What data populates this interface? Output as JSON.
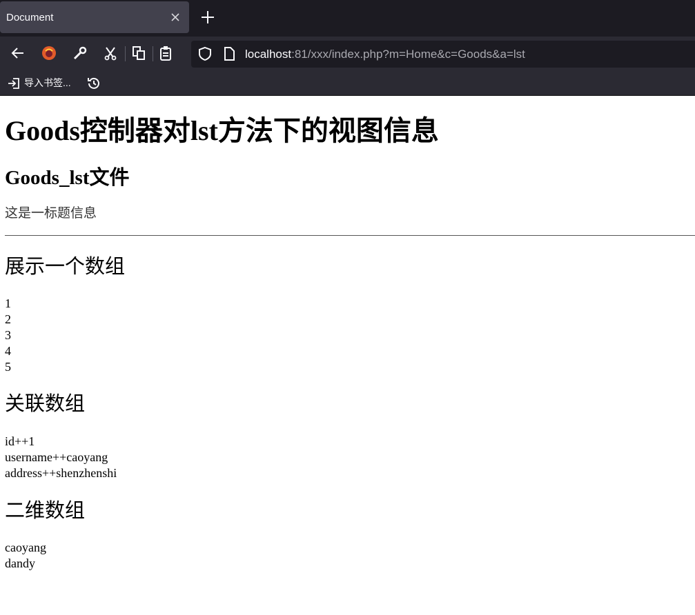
{
  "browser": {
    "tab_title": "Document",
    "url_host": "localhost",
    "url_rest": ":81/xxx/index.php?m=Home&c=Goods&a=lst",
    "bookmark_import_label": "导入书签..."
  },
  "page": {
    "heading": "Goods控制器对lst方法下的视图信息",
    "subheading": "Goods_lst文件",
    "subtitle": "这是一标题信息",
    "sections": [
      {
        "title": "展示一个数组",
        "items": [
          "1",
          "2",
          "3",
          "4",
          "5"
        ]
      },
      {
        "title": "关联数组",
        "items": [
          "id++1",
          "username++caoyang",
          "address++shenzhenshi"
        ]
      },
      {
        "title": "二维数组",
        "items": [
          "caoyang",
          "dandy"
        ]
      }
    ]
  },
  "icons": [
    "back-icon",
    "firefox-account-icon",
    "wrench-icon",
    "scissors-icon",
    "copy-icon",
    "paste-icon",
    "shield-icon",
    "page-icon",
    "import-icon",
    "history-icon",
    "close-icon",
    "plus-icon"
  ],
  "colors": {
    "chrome_bg": "#1c1b22",
    "toolbar_bg": "#2b2a33",
    "tab_bg": "#42414d"
  }
}
